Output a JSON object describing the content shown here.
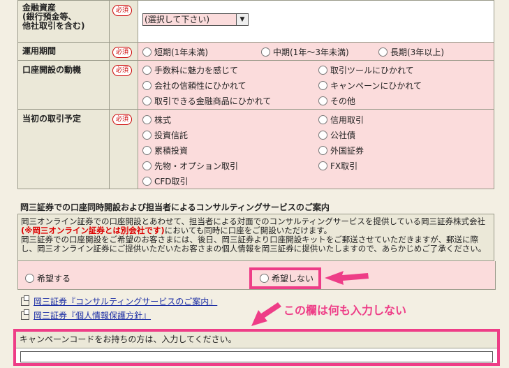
{
  "form": {
    "financial_assets": {
      "label_lines": [
        "金融資産",
        "(銀行預金等、",
        "他社取引を含む)"
      ],
      "required": "必須",
      "select_value": "(選択して下さい)"
    },
    "investment_period": {
      "label": "運用期間",
      "required": "必須",
      "options": [
        "短期(1年未満)",
        "中期(1年～3年未満)",
        "長期(3年以上)"
      ]
    },
    "opening_motive": {
      "label": "口座開設の動機",
      "required": "必須",
      "options": [
        "手数料に魅力を感じて",
        "取引ツールにひかれて",
        "会社の信頼性にひかれて",
        "キャンペーンにひかれて",
        "取引できる金融商品にひかれて",
        "その他"
      ]
    },
    "initial_trading": {
      "label": "当初の取引予定",
      "required": "必須",
      "options": [
        "株式",
        "信用取引",
        "投資信託",
        "公社債",
        "累積投資",
        "外国証券",
        "先物・オプション取引",
        "FX取引",
        "CFD取引"
      ]
    }
  },
  "consulting": {
    "title": "岡三証券での口座同時開設および担当者によるコンサルティングサービスのご案内",
    "notice_pre": "岡三オンライン証券での口座開設とあわせて、担当者による対面でのコンサルティングサービスを提供している岡三証券株式会社",
    "notice_red": "(※岡三オンライン証券とは別会社です)",
    "notice_mid": "においても同時に口座をご開設いただけます。",
    "notice_body": "岡三証券での口座開設をご希望のお客さまには、後日、岡三証券より口座開設キットをご郵送させていただきますが、郵送に際し、岡三オンライン証券にご提供いただいたお客さまの個人情報を岡三証券に提供いたしますので、あらかじめご了承ください。",
    "option_yes": "希望する",
    "option_no": "希望しない"
  },
  "links": {
    "consulting_guide": "岡三証券『コンサルティングサービスのご案内』",
    "privacy_policy": "岡三証券『個人情報保護方針』"
  },
  "annotation": {
    "callout": "この欄は何も入力しない",
    "color": "#ee3d87"
  },
  "campaign": {
    "label": "キャンペーンコードをお持ちの方は、入力してください。"
  }
}
